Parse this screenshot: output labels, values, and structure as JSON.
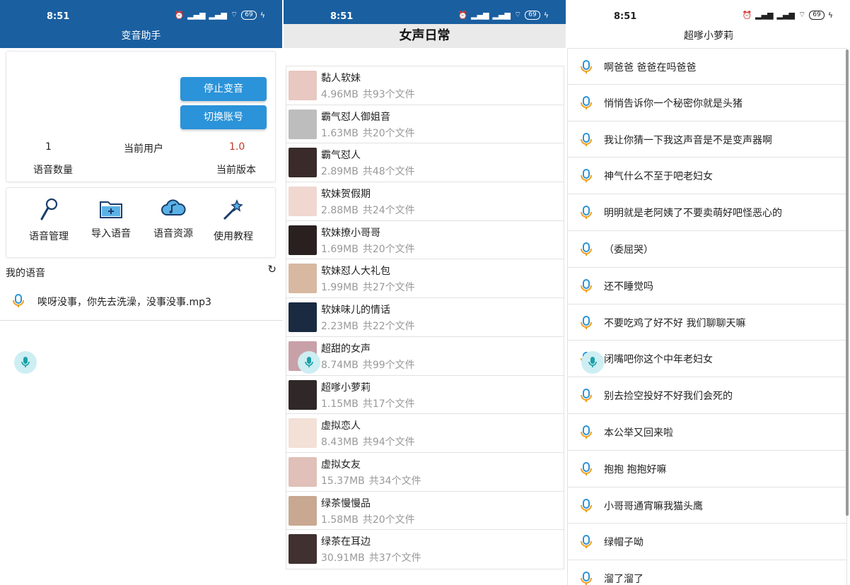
{
  "status": {
    "time": "8:51",
    "battery": "69"
  },
  "panel1": {
    "title": "变音助手",
    "stop_btn": "停止变音",
    "switch_btn": "切换账号",
    "voice_count_value": "1",
    "current_user_label": "当前用户",
    "version_value": "1.0",
    "voice_count_label": "语音数量",
    "version_label": "当前版本",
    "features": [
      {
        "label": "语音管理",
        "icon": "microphone-icon"
      },
      {
        "label": "导入语音",
        "icon": "folder-add-icon"
      },
      {
        "label": "语音资源",
        "icon": "cloud-music-icon"
      },
      {
        "label": "使用教程",
        "icon": "magic-wand-icon"
      }
    ],
    "my_voice_title": "我的语音",
    "my_voices": [
      "唉呀没事，你先去洗澡，没事没事.mp3"
    ]
  },
  "panel2": {
    "title": "女声日常",
    "items": [
      {
        "name": "黏人软妹",
        "size": "4.96MB",
        "count": "共93个文件"
      },
      {
        "name": "霸气怼人御姐音",
        "size": "1.63MB",
        "count": "共20个文件"
      },
      {
        "name": "霸气怼人",
        "size": "2.89MB",
        "count": "共48个文件"
      },
      {
        "name": "软妹贺假期",
        "size": "2.88MB",
        "count": "共24个文件"
      },
      {
        "name": "软妹撩小哥哥",
        "size": "1.69MB",
        "count": "共20个文件"
      },
      {
        "name": "软妹怼人大礼包",
        "size": "1.99MB",
        "count": "共27个文件"
      },
      {
        "name": "软妹味儿的情话",
        "size": "2.23MB",
        "count": "共22个文件"
      },
      {
        "name": "超甜的女声",
        "size": "8.74MB",
        "count": "共99个文件"
      },
      {
        "name": "超嗲小萝莉",
        "size": "1.15MB",
        "count": "共17个文件"
      },
      {
        "name": "虚拟恋人",
        "size": "8.43MB",
        "count": "共94个文件"
      },
      {
        "name": "虚拟女友",
        "size": "15.37MB",
        "count": "共34个文件"
      },
      {
        "name": "绿茶慢慢品",
        "size": "1.58MB",
        "count": "共20个文件"
      },
      {
        "name": "绿茶在耳边",
        "size": "30.91MB",
        "count": "共37个文件"
      }
    ]
  },
  "panel3": {
    "title": "超嗲小萝莉",
    "items": [
      "啊爸爸 爸爸在吗爸爸",
      "悄悄告诉你一个秘密你就是头猪",
      "我让你猜一下我这声音是不是变声器啊",
      "神气什么不至于吧老妇女",
      "明明就是老阿姨了不要卖萌好吧怪恶心的",
      "（委屈哭）",
      "还不睡觉吗",
      "不要吃鸡了好不好 我们聊聊天嘛",
      "闭嘴吧你这个中年老妇女",
      "别去捡空投好不好我们会死的",
      "本公举又回来啦",
      "抱抱 抱抱好嘛",
      "小哥哥通宵嘛我猫头鹰",
      "绿帽子呦",
      "溜了溜了"
    ]
  },
  "colors": {
    "primary": "#1a5fa0",
    "button": "#2b93d9",
    "version": "#c0392b"
  }
}
